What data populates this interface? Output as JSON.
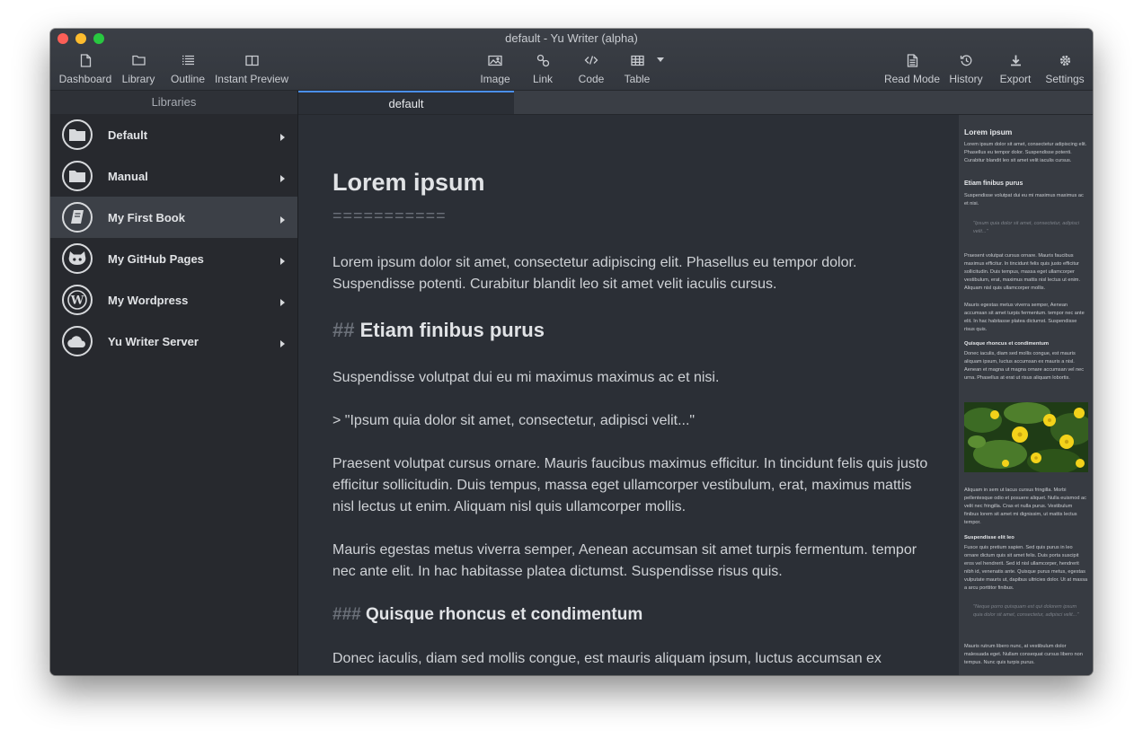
{
  "window": {
    "title": "default - Yu Writer (alpha)"
  },
  "toolbar": {
    "dashboard": "Dashboard",
    "library": "Library",
    "outline": "Outline",
    "instant_preview": "Instant Preview",
    "image": "Image",
    "link": "Link",
    "code": "Code",
    "table": "Table",
    "read_mode": "Read Mode",
    "history": "History",
    "export": "Export",
    "settings": "Settings"
  },
  "sidebar": {
    "header": "Libraries",
    "items": [
      {
        "label": "Default",
        "icon": "folder-icon"
      },
      {
        "label": "Manual",
        "icon": "folder-icon"
      },
      {
        "label": "My First Book",
        "icon": "book-icon",
        "active": true
      },
      {
        "label": "My GitHub Pages",
        "icon": "github-icon"
      },
      {
        "label": "My Wordpress",
        "icon": "wordpress-icon"
      },
      {
        "label": "Yu Writer Server",
        "icon": "cloud-icon"
      }
    ]
  },
  "tabs": [
    {
      "label": "default",
      "active": true
    }
  ],
  "editor": {
    "h1": "Lorem ipsum",
    "h1_underline": "===========",
    "p1": "Lorem ipsum dolor sit amet, consectetur adipiscing elit. Phasellus eu tempor dolor. Suspendisse potenti. Curabitur blandit leo sit amet velit iaculis cursus.",
    "h2_marker": "##",
    "h2": "Etiam finibus purus",
    "p2": "Suspendisse volutpat dui eu mi maximus maximus ac et nisi.",
    "quote": "> \"Ipsum quia dolor sit amet, consectetur, adipisci velit...\"",
    "p3": "Praesent volutpat cursus ornare. Mauris faucibus maximus efficitur. In tincidunt felis quis justo efficitur sollicitudin. Duis tempus, massa eget ullamcorper vestibulum, erat, maximus mattis nisl lectus ut enim. Aliquam nisl quis ullamcorper mollis.",
    "p4": "Mauris egestas metus viverra semper, Aenean accumsan sit amet turpis fermentum. tempor nec ante elit. In hac habitasse platea dictumst. Suspendisse risus quis.",
    "h3_marker": "###",
    "h3": "Quisque rhoncus et condimentum",
    "p5": "Donec iaculis, diam sed mollis congue, est mauris aliquam ipsum, luctus accumsan ex"
  },
  "preview": {
    "h1": "Lorem ipsum",
    "p1": "Lorem ipsum dolor sit amet, consectetur adipiscing elit. Phasellus eu tempor dolor. Suspendisse potenti. Curabitur blandit leo sit amet velit iaculis cursus.",
    "h2": "Etiam finibus purus",
    "p2": "Suspendisse volutpat dui eu mi maximus maximus ac et nisi.",
    "quote": "\"Ipsum quia dolor sit amet, consectetur, adipisci velit...\"",
    "p3": "Praesent volutpat cursus ornare. Mauris faucibus maximus efficitur. In tincidunt felis quis justo efficitur sollicitudin. Duis tempus, massa eget ullamcorper vestibulum, erat, maximus mattis nisl lectus ut enim. Aliquam nisl quis ullamcorper mollis.",
    "p4": "Mauris egestas metus viverra semper, Aenean accumsan sit amet turpis fermentum. tempor nec ante elit. In hac habitasse platea dictumst. Suspendisse risus quis.",
    "h3": "Quisque rhoncus et condimentum",
    "p5": "Donec iaculis, diam sed mollis congue, est mauris aliquam ipsum, luctus accumsan ex mauris a nisl. Aenean et magna ut magna ornare accumsan vel nec urna. Phasellus at erat ut risus aliquam lobortis.",
    "p6": "Aliquam in sem ut lacus cursus fringilla. Morbi pellentesque odio et posuere aliquet. Nulla euismod ac velit nec fringilla. Cras et nulla purus. Vestibulum finibus lorem sit amet mi dignissim, ut mattis lectus tempor.",
    "h3b": "Suspendisse elit leo",
    "p7": "Fusce quis pretium sapien. Sed quis purus in leo ornare dictum quis sit amet felis. Duis porta suscipit eros vel hendrerit. Sed id nisl ullamcorper, hendrerit nibh id, venenatis ante. Quisque purus metus, egestas vulputate mauris ut, dapibus ultricies dolor. Ut at massa a arcu porttitor finibus.",
    "quote2": "\"Neque porro quisquam est qui dolorem ipsum quia dolor sit amet, consectetur, adipisci velit...\"",
    "p8": "Mauris rutrum libero nunc, at vestibulum dolor malesuada eget. Nullam consequat cursus libero non tempus. Nunc quis turpis purus."
  },
  "colors": {
    "window_bg": "#2b2f36",
    "sidebar_bg": "#27292e",
    "active_item": "#3c4047",
    "accent": "#4a8ff0"
  }
}
